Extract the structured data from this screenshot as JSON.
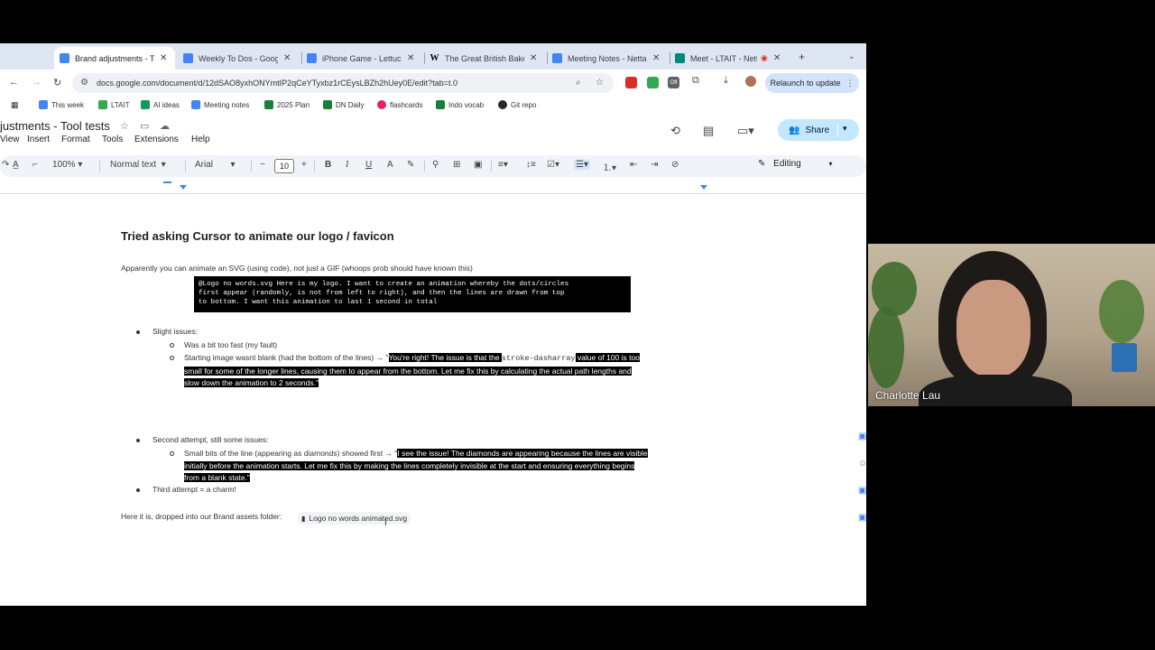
{
  "tabs": [
    {
      "title": "Brand adjustments - Tool tests",
      "active": true,
      "icon": "docs-icon"
    },
    {
      "title": "Weekly To Dos - Google Docs",
      "active": false,
      "icon": "docs-icon"
    },
    {
      "title": "iPhone Game - Lettuce",
      "active": false,
      "icon": "docs-icon"
    },
    {
      "title": "The Great British Bake Off",
      "active": false,
      "icon": "wikipedia-icon"
    },
    {
      "title": "Meeting Notes - Netta",
      "active": false,
      "icon": "docs-icon"
    },
    {
      "title": "Meet - LTAIT - Netta",
      "active": false,
      "icon": "meet-icon"
    }
  ],
  "address": {
    "url": "docs.google.com/document/d/12dSAO8yxhONYmtIP2qCeYTyxbz1rCEysLBZh2hUey0E/edit?tab=t.0",
    "relaunch_label": "Relaunch to update",
    "ext_badge": "Off"
  },
  "bookmarks": [
    {
      "label": "This week",
      "color": "#4285f4"
    },
    {
      "label": "LTAIT",
      "color": "#34a853"
    },
    {
      "label": "AI ideas",
      "color": "#0f9d58"
    },
    {
      "label": "Meeting notes",
      "color": "#4285f4"
    },
    {
      "label": "2025 Plan",
      "color": "#188038"
    },
    {
      "label": "DN Daily",
      "color": "#188038"
    },
    {
      "label": "flashcards",
      "color": "#e91e63"
    },
    {
      "label": "Indo vocab",
      "color": "#188038"
    },
    {
      "label": "Git repo",
      "color": "#24292e"
    }
  ],
  "docs": {
    "title": "justments - Tool tests",
    "menus": [
      "View",
      "Insert",
      "Format",
      "Tools",
      "Extensions",
      "Help"
    ],
    "share_label": "Share",
    "zoom": "100%",
    "style": "Normal text",
    "font": "Arial",
    "font_size": "10",
    "mode": "Editing"
  },
  "content": {
    "heading": "Tried asking Cursor to animate our logo / favicon",
    "intro": "Apparently you can animate an SVG (using code), not just a GIF (whoops prob should have known this)",
    "code_lines": [
      "@Logo no words.svg Here is my logo. I want to create an animation whereby the dots/circles",
      "first appear (randomly, is not from left to right), and then the lines are drawn from top",
      "to bottom. I want this animation to last 1 second in total"
    ],
    "b1": "Slight issues:",
    "b1a": "Was a bit too fast (my fault)",
    "b1b_prefix": "Starting image wasnt blank (had the bottom of the lines) → \"",
    "b1b_hl1": "You're right! The issue is that the ",
    "b1b_code": "stroke-dasharray",
    "b1b_hl2": " value of 100 is too",
    "b1b_line2": "small for some of the longer lines, causing them to appear from the bottom. Let me fix this by calculating the actual path lengths and",
    "b1b_line3": "slow down the animation to 2 seconds.\"",
    "b2": "Second attempt, still some issues:",
    "b2a_prefix": "Small bits of the line (appearing as diamonds) showed first → \"",
    "b2a_hl1": "I see the issue! The diamonds are appearing because the lines are visible",
    "b2a_line2": "initially before the animation starts. Let me fix this by making the lines completely invisible at the start and ensuring everything begins",
    "b2a_line3": "from a blank state.\"",
    "b3": "Third attempt = a charm!",
    "final_prefix": "Here it is, dropped into our Brand assets folder:",
    "file_chip": "Logo no words animated.svg"
  },
  "video": {
    "participant": "Charlotte Lau"
  },
  "colors": {
    "accent": "#4285f4",
    "share_bg": "#c2e7ff",
    "relaunch_bg": "#d3e3fd"
  }
}
